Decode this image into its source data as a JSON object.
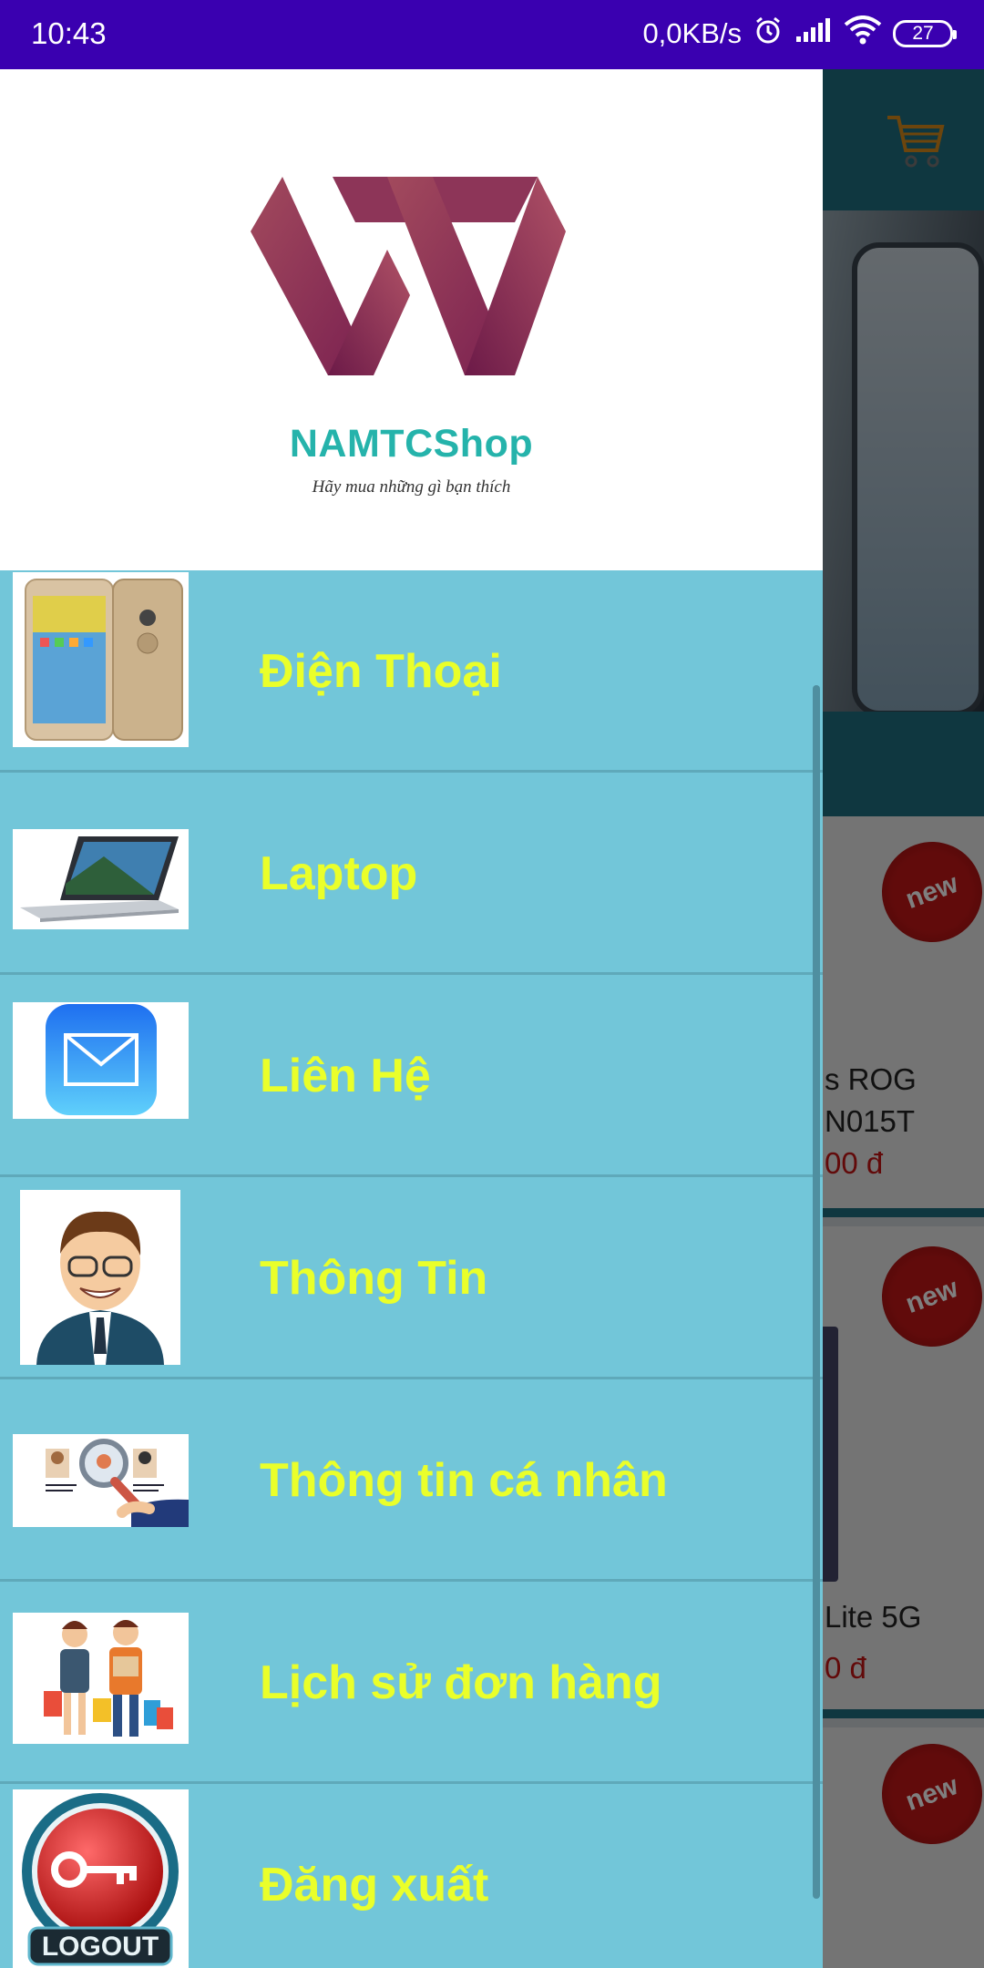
{
  "status_bar": {
    "time": "10:43",
    "network_speed": "0,0KB/s",
    "battery": "27",
    "icons": [
      "alarm-icon",
      "signal-icon",
      "wifi-icon",
      "battery-icon"
    ]
  },
  "background_app": {
    "card1": {
      "badge": "new",
      "name_line1": "s ROG",
      "name_line2": "N015T",
      "price": "00 đ"
    },
    "card2": {
      "badge": "new",
      "name_line1": "Lite 5G",
      "price": "0 đ"
    },
    "card3": {
      "badge": "new"
    }
  },
  "drawer": {
    "brand": {
      "name": "NAMTCShop",
      "tagline": "Hãy mua những gì bạn thích"
    },
    "items": [
      {
        "label": "Điện Thoại",
        "icon": "phone-image"
      },
      {
        "label": "Laptop",
        "icon": "laptop-image"
      },
      {
        "label": "Liên Hệ",
        "icon": "mail-icon"
      },
      {
        "label": "Thông Tin",
        "icon": "person-avatar-image"
      },
      {
        "label": "Thông tin cá nhân",
        "icon": "profile-search-image"
      },
      {
        "label": "Lịch sử đơn hàng",
        "icon": "shopping-people-image"
      },
      {
        "label": "Đăng xuất",
        "icon": "logout-icon"
      }
    ],
    "colors": {
      "background": "#72c6d9",
      "label": "#eaff2a",
      "brand": "#25b3ab",
      "status_bar": "#3a00b0"
    }
  }
}
